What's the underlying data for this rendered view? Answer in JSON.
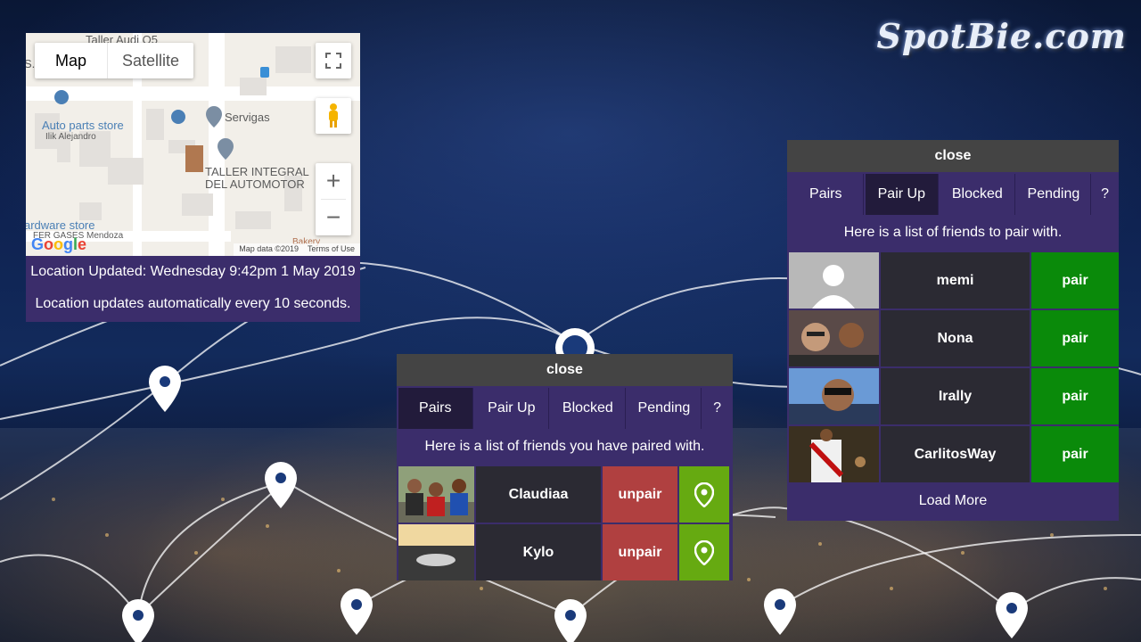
{
  "logo": {
    "text": "SpotBie.com"
  },
  "map": {
    "type_buttons": [
      "Map",
      "Satellite"
    ],
    "labels": {
      "taller_audi": "Taller Audi Q5",
      "auto_parts": "Auto parts store",
      "ilik": "Ilik Alejandro",
      "servigas": "Servigas",
      "taller_integral_1": "TALLER INTEGRAL",
      "taller_integral_2": "DEL AUTOMOTOR",
      "hardware": "ardware store",
      "gases": "FER GASES Mendoza",
      "bakery": "Bakery",
      "partial_left": "S.A"
    },
    "google_logo": "Google",
    "footer": {
      "data": "Map data ©2019",
      "terms": "Terms of Use"
    },
    "zoom_in": "+",
    "zoom_out": "−",
    "location_updated": "Location Updated: Wednesday 9:42pm 1 May 2019",
    "update_note": "Location updates automatically every 10 seconds."
  },
  "pairs_panel": {
    "close_label": "close",
    "tabs": [
      "Pairs",
      "Pair Up",
      "Blocked",
      "Pending",
      "?"
    ],
    "active_tab": "Pairs",
    "hint": "Here is a list of friends you have paired with.",
    "friends": [
      {
        "name": "Claudiaa",
        "action": "unpair"
      },
      {
        "name": "Kylo",
        "action": "unpair"
      }
    ]
  },
  "pairup_panel": {
    "close_label": "close",
    "tabs": [
      "Pairs",
      "Pair Up",
      "Blocked",
      "Pending",
      "?"
    ],
    "active_tab": "Pair Up",
    "hint": "Here is a list of friends to pair with.",
    "friends": [
      {
        "name": "memi",
        "action": "pair"
      },
      {
        "name": "Nona",
        "action": "pair"
      },
      {
        "name": "Irally",
        "action": "pair"
      },
      {
        "name": "CarlitosWay",
        "action": "pair"
      }
    ],
    "load_more": "Load More"
  },
  "colors": {
    "panel": "#3b2d6b",
    "close_bar": "#444444",
    "unpair": "#b04040",
    "pair": "#0a8a0a",
    "locate": "#66aa11"
  }
}
